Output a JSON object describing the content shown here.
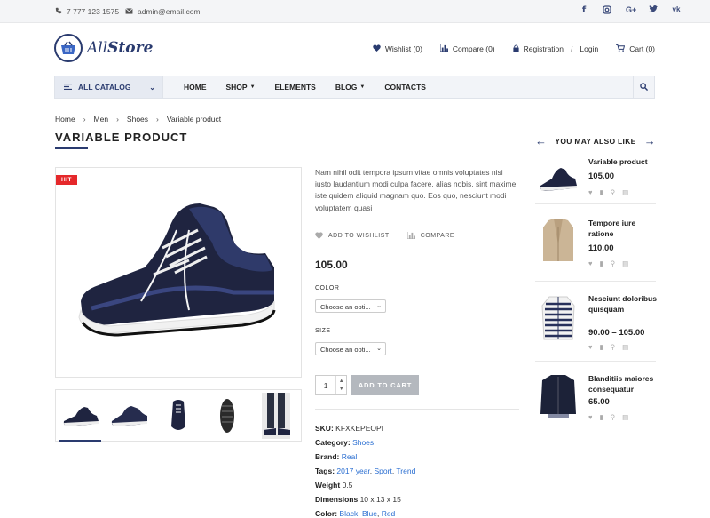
{
  "topbar": {
    "phone": "7 777 123 1575",
    "email": "admin@email.com",
    "social": [
      "f",
      "ig",
      "G+",
      "tw",
      "vk"
    ]
  },
  "header": {
    "logo_all": "All",
    "logo_store": "Store",
    "wishlist": "Wishlist (0)",
    "compare": "Compare (0)",
    "registration": "Registration",
    "login": "Login",
    "cart": "Cart (0)"
  },
  "nav": {
    "catalog": "ALL CATALOG",
    "items": [
      "HOME",
      "SHOP",
      "ELEMENTS",
      "BLOG",
      "CONTACTS"
    ]
  },
  "breadcrumb": [
    "Home",
    "Men",
    "Shoes",
    "Variable product"
  ],
  "product": {
    "title": "VARIABLE PRODUCT",
    "badge": "HIT",
    "description": "Nam nihil odit tempora ipsum vitae omnis voluptates nisi iusto laudantium modi culpa facere, alias nobis, sint maxime iste quidem aliquid magnam quo. Eos quo, nesciunt modi voluptatem quasi",
    "add_to_wishlist": "ADD TO WISHLIST",
    "compare": "COMPARE",
    "price": "105.00",
    "color_label": "COLOR",
    "color_select": "Choose an opti...",
    "size_label": "SIZE",
    "size_select": "Choose an opti...",
    "quantity": "1",
    "add_to_cart": "ADD TO CART",
    "sku_label": "SKU:",
    "sku": "KFXKEPEOPI",
    "category_label": "Category:",
    "category": "Shoes",
    "brand_label": "Brand:",
    "brand": "Real",
    "tags_label": "Tags:",
    "tags": [
      "2017 year",
      "Sport",
      "Trend"
    ],
    "weight_label": "Weight",
    "weight": "0.5",
    "dimensions_label": "Dimensions",
    "dimensions": "10 x 13 x 15",
    "color_meta_label": "Color:",
    "colors": [
      "Black",
      "Blue",
      "Red"
    ]
  },
  "sidebar": {
    "heading": "YOU MAY ALSO LIKE",
    "items": [
      {
        "name": "Variable product",
        "price": "105.00"
      },
      {
        "name": "Tempore iure ratione",
        "price": "110.00"
      },
      {
        "name": "Nesciunt doloribus quisquam",
        "price": "90.00 – 105.00"
      },
      {
        "name": "Blanditiis maiores consequatur",
        "price": "65.00"
      }
    ]
  },
  "colors": {
    "brand": "#2a3b6f",
    "hit": "#e5282b",
    "link": "#2a6ed1",
    "button": "#b4b8be"
  }
}
